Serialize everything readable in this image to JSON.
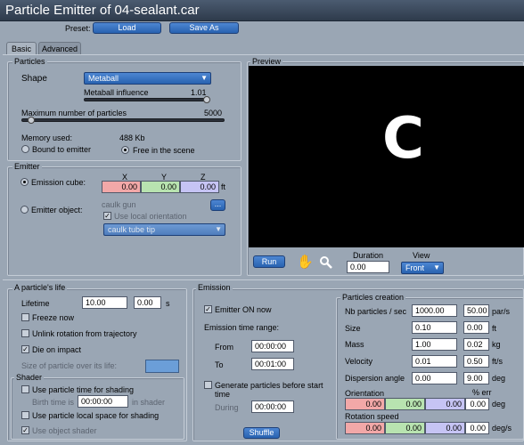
{
  "window": {
    "title": "Particle Emitter of 04-sealant.car"
  },
  "toolbar": {
    "preset_label": "Preset:",
    "load_label": "Load",
    "save_as_label": "Save As"
  },
  "tabs": [
    {
      "label": "Basic"
    },
    {
      "label": "Advanced"
    }
  ],
  "particles": {
    "section_label": "Particles",
    "shape_label": "Shape",
    "shape_value": "Metaball",
    "metaball_influence_label": "Metaball influence",
    "metaball_influence_value": "1.01",
    "max_particles_label": "Maximum number of particles",
    "max_particles_value": "5000",
    "memory_label": "Memory used:",
    "memory_value": "488 Kb",
    "bound_to_emitter_label": "Bound to emitter",
    "free_in_scene_label": "Free in the scene"
  },
  "emitter": {
    "section_label": "Emitter",
    "x_label": "X",
    "y_label": "Y",
    "z_label": "Z",
    "emission_cube_label": "Emission cube:",
    "cube_x": "0.00",
    "cube_y": "0.00",
    "cube_z": "0.00",
    "cube_unit": "ft",
    "emitter_object_label": "Emitter object:",
    "object_name": "caulk gun",
    "browse_label": "...",
    "use_local_orientation_label": "Use local orientation",
    "object_part": "caulk tube tip"
  },
  "preview": {
    "section_label": "Preview",
    "letter": "C",
    "run_label": "Run",
    "duration_label": "Duration",
    "duration_value": "0.00",
    "view_label": "View",
    "view_value": "Front"
  },
  "life": {
    "section_label": "A particle's life",
    "lifetime_label": "Lifetime",
    "lifetime_value": "10.00",
    "lifetime_var": "0.00",
    "lifetime_unit": "s",
    "freeze_now_label": "Freeze now",
    "unlink_rotation_label": "Unlink rotation from trajectory",
    "die_on_impact_label": "Die on impact",
    "size_over_life_label": "Size of particle over its life:",
    "shader_label": "Shader",
    "use_particle_time_label": "Use particle time for shading",
    "birth_time_label": "Birth time is",
    "birth_time_value": "00:00:00",
    "in_shader_label": "in shader",
    "use_local_space_label": "Use particle local space for shading",
    "use_object_shader_label": "Use object shader"
  },
  "emission": {
    "section_label": "Emission",
    "emitter_on_label": "Emitter ON now",
    "range_label": "Emission time range:",
    "from_label": "From",
    "from_value": "00:00:00",
    "to_label": "To",
    "to_value": "00:01:00",
    "generate_before_label": "Generate particles before start time",
    "during_label": "During",
    "during_value": "00:00:00",
    "shuffle_label": "Shuffle"
  },
  "creation": {
    "section_label": "Particles creation",
    "err_header": "% err",
    "rows": [
      {
        "label": "Nb particles / sec",
        "value": "1000.00",
        "err": "50.00",
        "unit": "par/s"
      },
      {
        "label": "Size",
        "value": "0.10",
        "err": "0.00",
        "unit": "ft"
      },
      {
        "label": "Mass",
        "value": "1.00",
        "err": "0.02",
        "unit": "kg"
      },
      {
        "label": "Velocity",
        "value": "0.01",
        "err": "0.50",
        "unit": "ft/s"
      },
      {
        "label": "Dispersion angle",
        "value": "0.00",
        "err": "9.00",
        "unit": "deg"
      }
    ],
    "orientation_label": "Orientation",
    "orientation": {
      "x": "0.00",
      "y": "0.00",
      "z": "0.00",
      "err": "0.00",
      "unit": "deg"
    },
    "rotation_label": "Rotation speed",
    "rotation": {
      "x": "0.00",
      "y": "0.00",
      "z": "0.00",
      "err": "0.00",
      "unit": "deg/s"
    }
  },
  "colors": {
    "accent": "#2d6bc4",
    "panel_bg": "#9aa6b4",
    "preview_bg": "#000000",
    "size_swatch": "#6b9ed8"
  },
  "icons": [
    "hand-icon",
    "magnifier-icon",
    "chevron-down-icon"
  ]
}
